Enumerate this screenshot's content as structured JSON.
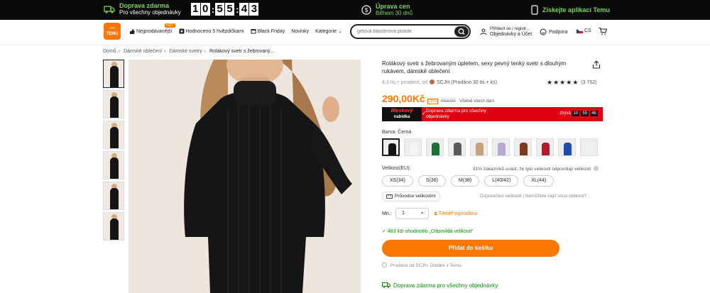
{
  "topbar": {
    "shipping_title": "Doprava zdarma",
    "shipping_sub": "Pro všechny objednávky",
    "timer": [
      "1",
      "0",
      "5",
      "5",
      "4",
      "3"
    ],
    "price_adj_title": "Úprava cen",
    "price_adj_sub": "Během 30 dnů",
    "app_label": "Získejte aplikaci Temu"
  },
  "header": {
    "logo_text": "TEMU",
    "nav": [
      {
        "label": "Nejprodávanější",
        "icon": "thumbs-up-icon",
        "badge": "HOT"
      },
      {
        "label": "Hodnoceno 5 hvězdičkami",
        "icon": "star-box-icon"
      },
      {
        "label": "Black Friday",
        "icon": "calendar-icon"
      },
      {
        "label": "Novinky"
      },
      {
        "label": "Kategorie"
      }
    ],
    "search_placeholder": "gelová blasterová pistole",
    "account_line1": "Přihlásit se / registr...",
    "account_line2": "Objednávky a Účet",
    "support": "Podpora",
    "lang": "CS"
  },
  "breadcrumb": [
    "Domů",
    "Dámské oblečení",
    "Dámské svetry",
    "Rolákový svetr s žebrovaný..."
  ],
  "product": {
    "title": "Rolákový svetr s žebrovaným úpletem, sexy pevný tenký svetr s dlouhým rukávem, dámské oblečení",
    "meta": "4,3 tis.+ prodáno, od",
    "seller": "SCJH (Prodáno 30 tis.+ ks)",
    "rating_count": "(3 752)",
    "rating": 4.5,
    "price": "290,00Kč",
    "discount": "-35%",
    "old_price": "453,00",
    "price_note": "Včetně všech daní",
    "deal_badge_top": "Bleskový",
    "deal_badge_bottom": "nabídka",
    "deal_text": "Doprava zdarma pro všechny objednávky",
    "deal_ends_label": "zbývá",
    "deal_timer": [
      "10",
      "55",
      "46"
    ],
    "color_label": "Barva: Černá",
    "swatch_colors": [
      "#141414",
      "#f4f4f4",
      "#1f6e3a",
      "#5a5a5a",
      "#c8a07a",
      "#b9a7d6",
      "#7a3b1f",
      "#b51a2a",
      "#1d4fa8",
      "#f0f0f0"
    ],
    "size_label": "Velikost(EU):",
    "size_note": "91% zákazníků uvádí, že tyto velikosti odpovídají velikosti",
    "sizes": [
      "XS(34)",
      "S(36)",
      "M(38)",
      "L(40/42)",
      "XL(44)"
    ],
    "size_guide": "Průvodce velikostmi",
    "size_links": "Doporučení velikosti  |  Nemůžete najít svou velikost?",
    "qty_label": "Mn.:",
    "qty_value": "1",
    "stock_note": "Téměř vyprodáno",
    "fit_note": "483 lidí ohodnotilo „Odpovídá velikosti\"",
    "add_to_cart": "Přidat do košíku",
    "sold_by": "Prodáno od SCJH. Dodání z Temu.",
    "free_shipping": "Doprava zdarma pro všechny objednávky"
  }
}
